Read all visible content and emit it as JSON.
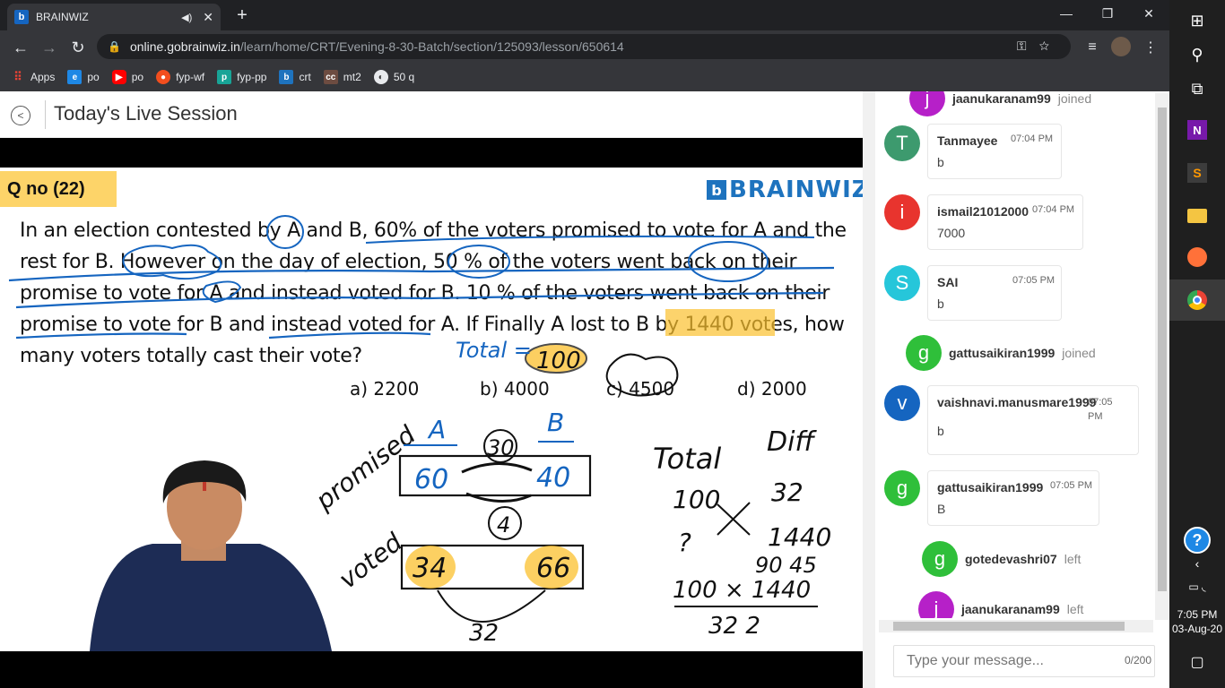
{
  "browser": {
    "tab_title": "BRAINWIZ",
    "tab_favicon": "b",
    "url_host": "online.gobrainwiz.in",
    "url_path": "/learn/home/CRT/Evening-8-30-Batch/section/125093/lesson/650614",
    "bookmarks": [
      {
        "label": "Apps",
        "icon": "apps-grid-icon",
        "color": "#e8eaed"
      },
      {
        "label": "po",
        "icon": "ie-icon",
        "color": "#1e88e5"
      },
      {
        "label": "po",
        "icon": "youtube-icon",
        "color": "#ff0000"
      },
      {
        "label": "fyp-wf",
        "icon": "figma-icon",
        "color": "#f24e1e"
      },
      {
        "label": "fyp-pp",
        "icon": "photopea-icon",
        "color": "#18a497"
      },
      {
        "label": "crt",
        "icon": "brainwiz-icon",
        "color": "#1e73be"
      },
      {
        "label": "mt2",
        "icon": "cc-icon",
        "color": "#6d4c41"
      },
      {
        "label": "50 q",
        "icon": "globe-icon",
        "color": "#e8eaed"
      }
    ]
  },
  "page": {
    "title": "Today's Live Session"
  },
  "slide": {
    "qno": "Q no (22)",
    "brand": "BRAINWIZ",
    "question_lines": [
      "In an election contested by A and B, 60% of the voters promised to vote for A and the",
      "rest for B. However on the day of election, 50 % of the voters went back on their",
      "promise to vote for A and instead voted for B. 10 % of the voters went back on their",
      "promise to vote for B and instead voted for A. If Finally A lost to B by 1440 votes, how",
      "many voters totally cast their vote?"
    ],
    "options": [
      "a) 2200",
      "b) 4000",
      "c) 4500",
      "d) 2000"
    ]
  },
  "chat": {
    "top_partial": {
      "name": "jaanukaranam99",
      "action": "joined",
      "initial": "j",
      "color": "#b620c8"
    },
    "items": [
      {
        "kind": "msg",
        "name": "Tanmayee",
        "time": "07:04 PM",
        "text": "b",
        "initial": "T",
        "color": "#3d9a6e"
      },
      {
        "kind": "msg",
        "name": "ismail21012000",
        "time": "07:04 PM",
        "text": "7000",
        "initial": "i",
        "color": "#e8342e"
      },
      {
        "kind": "msg",
        "name": "SAI",
        "time": "07:05 PM",
        "text": "b",
        "initial": "S",
        "color": "#26c6da"
      },
      {
        "kind": "evt",
        "name": "gattusaikiran1999",
        "action": "joined",
        "initial": "g",
        "color": "#2fbf3a"
      },
      {
        "kind": "msg",
        "name": "vaishnavi.manusmare1999",
        "time": "07:05 PM",
        "text": "b",
        "initial": "v",
        "color": "#1565c0"
      },
      {
        "kind": "msg",
        "name": "gattusaikiran1999",
        "time": "07:05 PM",
        "text": "B",
        "initial": "g",
        "color": "#2fbf3a"
      },
      {
        "kind": "evt",
        "name": "gotedevashri07",
        "action": "left",
        "initial": "g",
        "color": "#2fbf3a"
      },
      {
        "kind": "evt",
        "name": "jaanukaranam99",
        "action": "left",
        "initial": "j",
        "color": "#b620c8"
      }
    ],
    "input_placeholder": "Type your message...",
    "char_count": "0/200"
  },
  "taskbar": {
    "time": "7:05 PM",
    "date": "03-Aug-20"
  }
}
